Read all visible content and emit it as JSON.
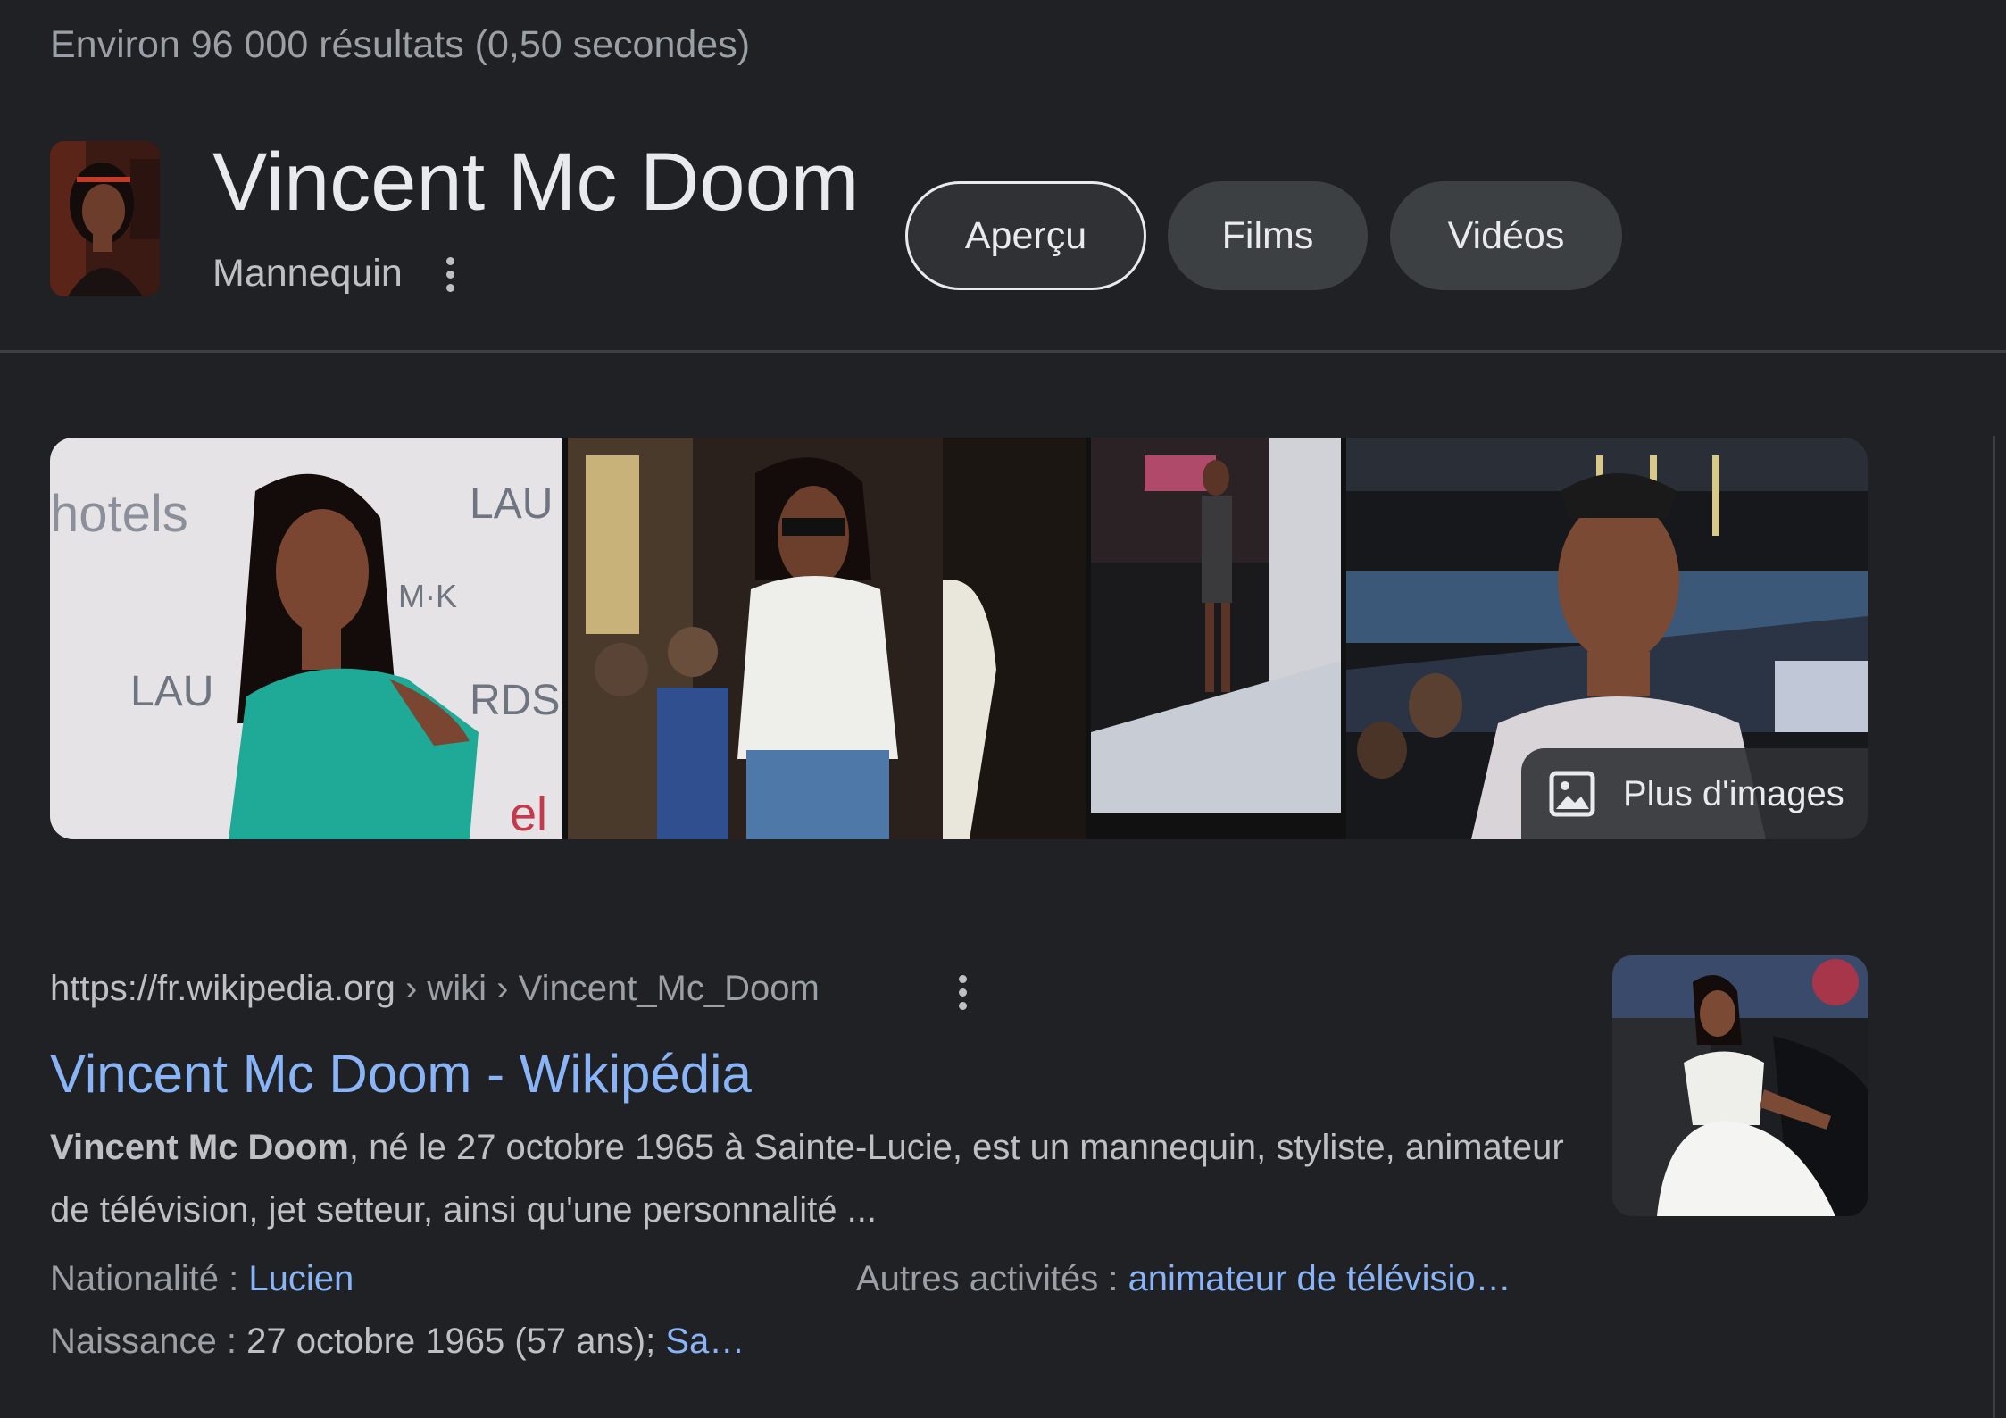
{
  "results_count": "Environ 96 000 résultats (0,50 secondes)",
  "entity": {
    "title": "Vincent Mc Doom",
    "subtitle": "Mannequin"
  },
  "chips": [
    {
      "label": "Aperçu",
      "active": true
    },
    {
      "label": "Films",
      "active": false
    },
    {
      "label": "Vidéos",
      "active": false
    }
  ],
  "images": {
    "more_label": "Plus d'images"
  },
  "result": {
    "url_host": "https://fr.wikipedia.org",
    "url_path": " › wiki › Vincent_Mc_Doom",
    "title": "Vincent Mc Doom - Wikipédia",
    "snippet_bold": "Vincent Mc Doom",
    "snippet_rest": ", né le 27 octobre 1965 à Sainte-Lucie, est un mannequin, styliste, animateur de télévision, jet setteur, ainsi qu'une personnalité ...",
    "attributes": {
      "nationality_label": "Nationalité : ",
      "nationality_value": "Lucien",
      "other_label": "Autres activités : ",
      "other_value": "animateur de télévisio…",
      "birth_label": "Naissance : ",
      "birth_value": "27 octobre 1965 (57 ans); ",
      "birth_link": "Sa…"
    }
  },
  "colors": {
    "background": "#202124",
    "link": "#8ab4f8",
    "text": "#bdc1c6",
    "title": "#e8eaed"
  }
}
